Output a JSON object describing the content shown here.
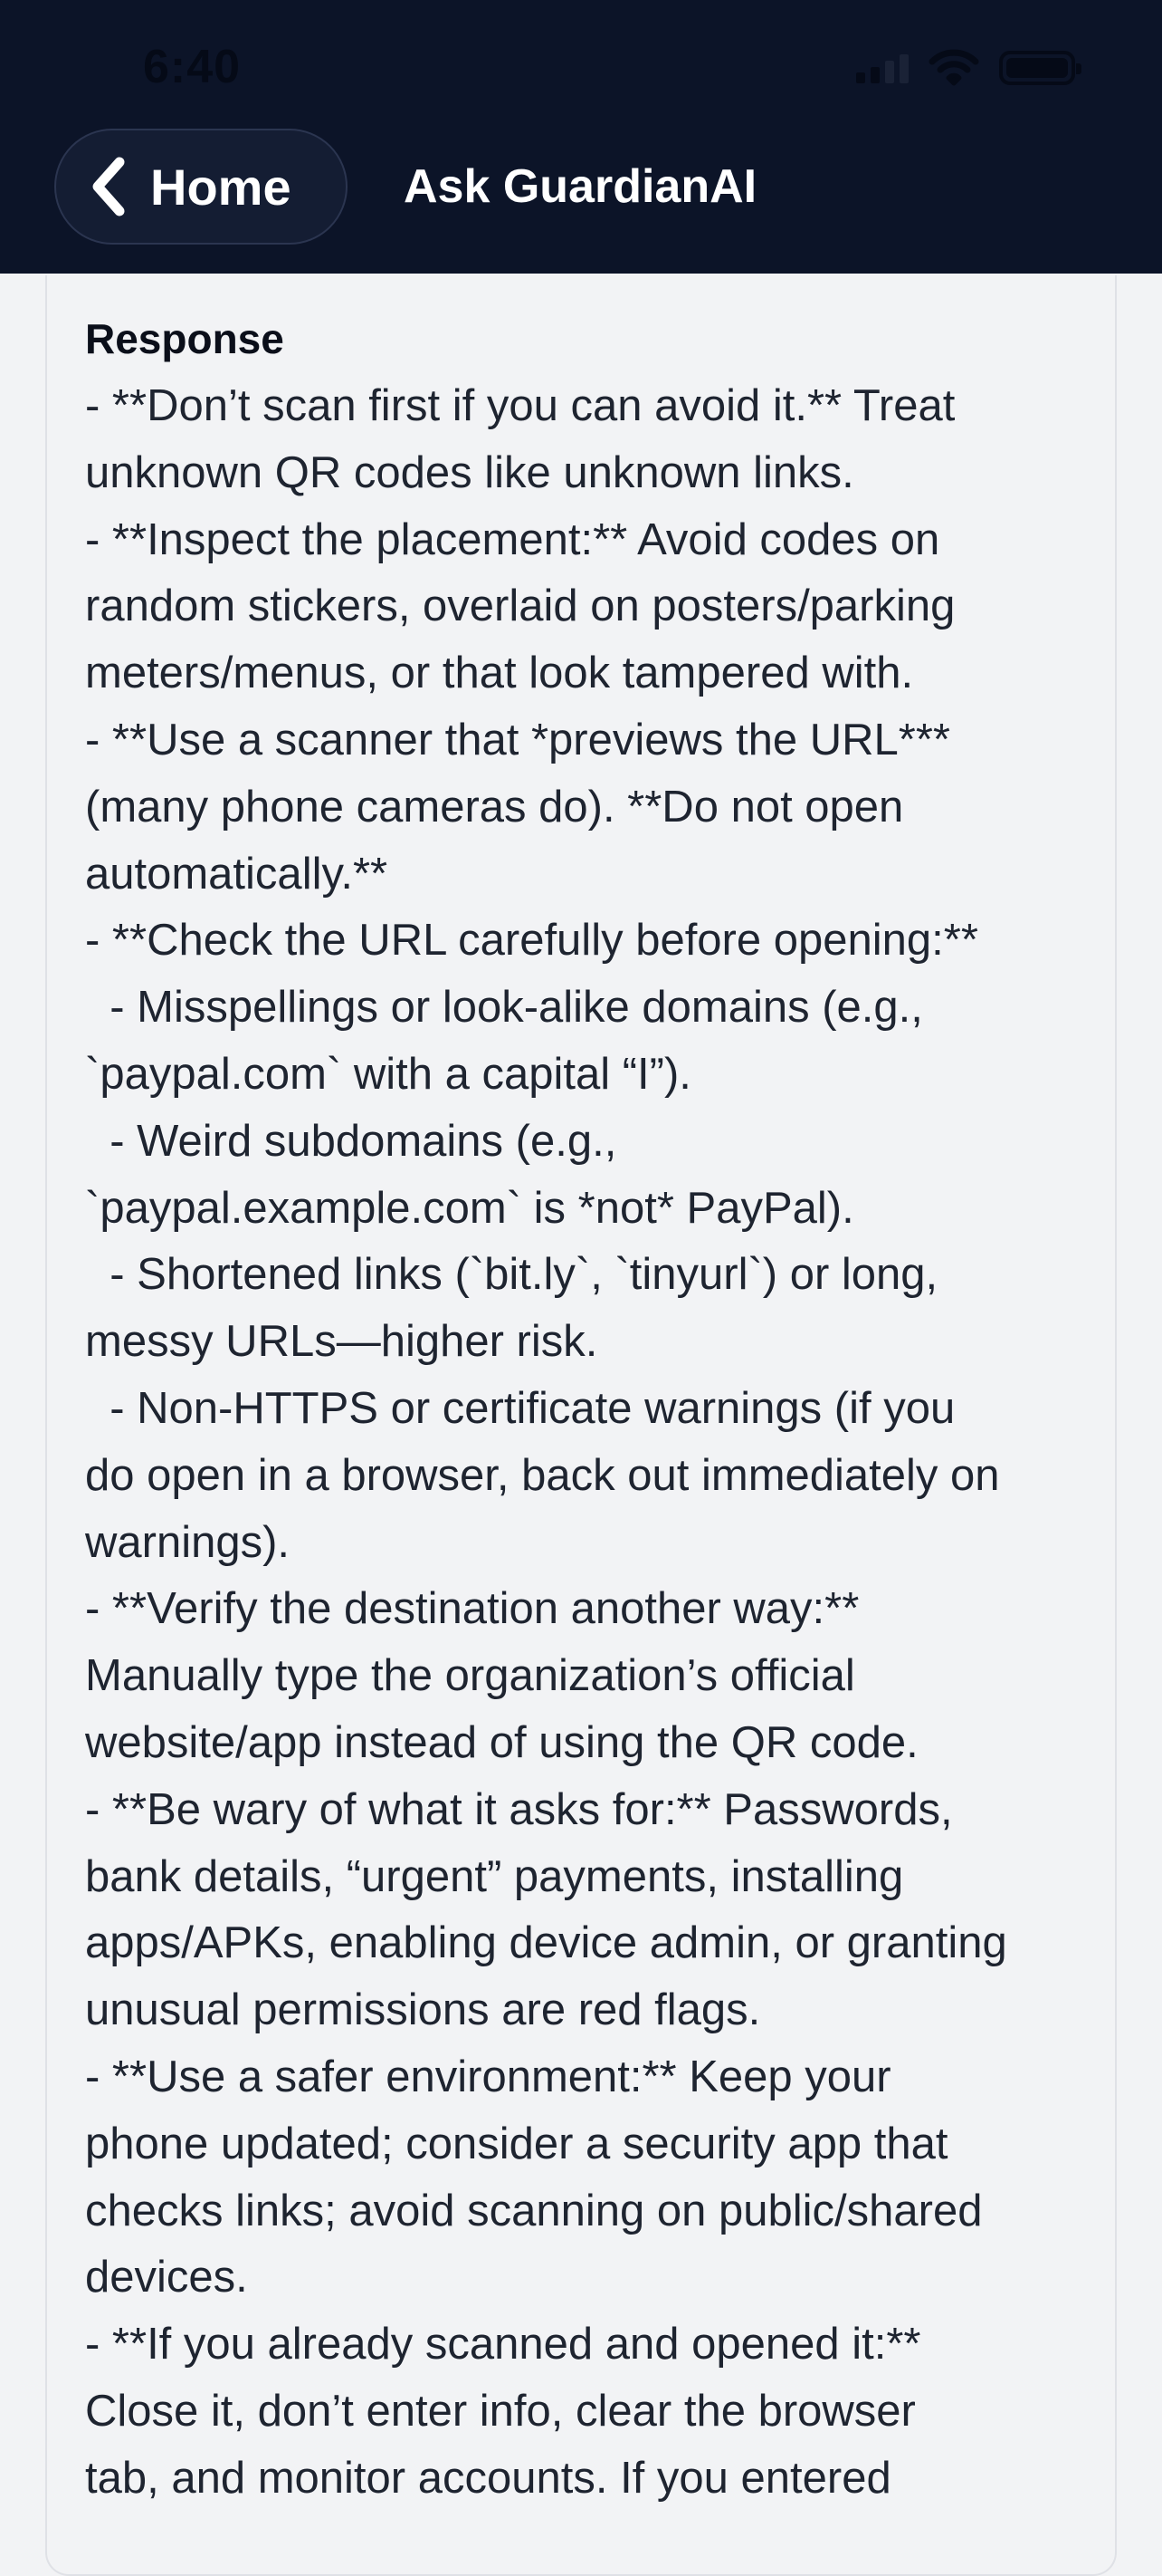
{
  "status_bar": {
    "time": "6:40"
  },
  "header": {
    "back_label": "Home",
    "title": "Ask GuardianAI"
  },
  "card": {
    "heading": "Response",
    "lines": [
      "- **Don’t scan first if you can avoid it.** Treat",
      "unknown QR codes like unknown links.",
      "- **Inspect the placement:** Avoid codes on",
      "random stickers, overlaid on posters/parking",
      "meters/menus, or that look tampered with.",
      "- **Use a scanner that *previews the URL***",
      "(many phone cameras do). **Do not open",
      "automatically.**",
      "- **Check the URL carefully before opening:**",
      "  - Misspellings or look-alike domains (e.g.,",
      "`paypal.com` with a capital “I”).",
      "  - Weird subdomains (e.g.,",
      "`paypal.example.com` is *not* PayPal).",
      "  - Shortened links (`bit.ly`, `tinyurl`) or long,",
      "messy URLs—higher risk.",
      "  - Non-HTTPS or certificate warnings (if you",
      "do open in a browser, back out immediately on",
      "warnings).",
      "- **Verify the destination another way:**",
      "Manually type the organization’s official",
      "website/app instead of using the QR code.",
      "- **Be wary of what it asks for:** Passwords,",
      "bank details, “urgent” payments, installing",
      "apps/APKs, enabling device admin, or granting",
      "unusual permissions are red flags.",
      "- **Use a safer environment:** Keep your",
      "phone updated; consider a security app that",
      "checks links; avoid scanning on public/shared",
      "devices.",
      "- **If you already scanned and opened it:**",
      "Close it, don’t enter info, clear the browser",
      "tab, and monitor accounts. If you entered"
    ]
  },
  "icons": {
    "back": "chevron-left-icon",
    "signal": "cellular-signal-icon",
    "wifi": "wifi-icon",
    "battery": "battery-icon"
  },
  "colors": {
    "header_bg": "#0c1428",
    "card_bg": "#f2f3f5",
    "text": "#1e2430"
  }
}
